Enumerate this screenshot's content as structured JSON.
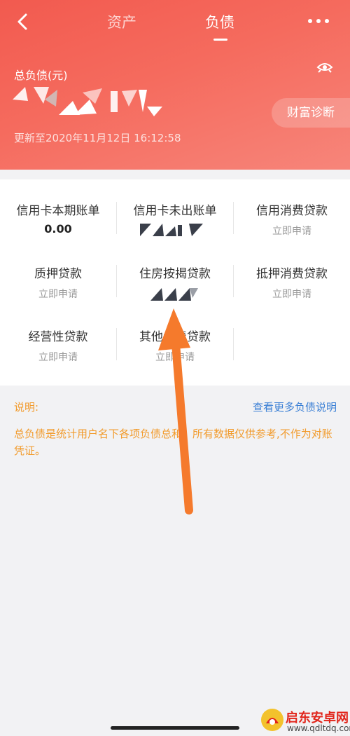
{
  "nav": {
    "back_icon": "chevron-left-icon",
    "tabs": [
      {
        "label": "资产",
        "active": false
      },
      {
        "label": "负债",
        "active": true
      }
    ],
    "more_icon": "more-dots-icon"
  },
  "summary": {
    "total_label": "总负债(元)",
    "eye_icon": "eye-icon",
    "diagnosis_button": "财富诊断",
    "update_time": "更新至2020年11月12日 16:12:58"
  },
  "items": [
    {
      "title": "信用卡本期账单",
      "value": "0.00"
    },
    {
      "title": "信用卡未出账单",
      "value": ""
    },
    {
      "title": "信用消费贷款",
      "subtitle": "立即申请"
    },
    {
      "title": "质押贷款",
      "subtitle": "立即申请"
    },
    {
      "title": "住房按揭贷款",
      "value": ""
    },
    {
      "title": "抵押消费贷款",
      "subtitle": "立即申请"
    },
    {
      "title": "经营性贷款",
      "subtitle": "立即申请"
    },
    {
      "title": "其他负债贷款",
      "subtitle": "立即申请"
    }
  ],
  "note": {
    "label": "说明:",
    "link": "查看更多负债说明",
    "text": "总负债是统计用户名下各项负债总和。所有数据仅供参考,不作为对账凭证。"
  },
  "colors": {
    "header_gradient_start": "#f25a4f",
    "header_gradient_end": "#f7857a",
    "note_orange": "#f29b2c",
    "link_blue": "#3a7fd5",
    "annotation_arrow": "#f57a2c"
  },
  "watermark": {
    "title": "启东安卓网",
    "url": "www.qdltdq.com"
  }
}
